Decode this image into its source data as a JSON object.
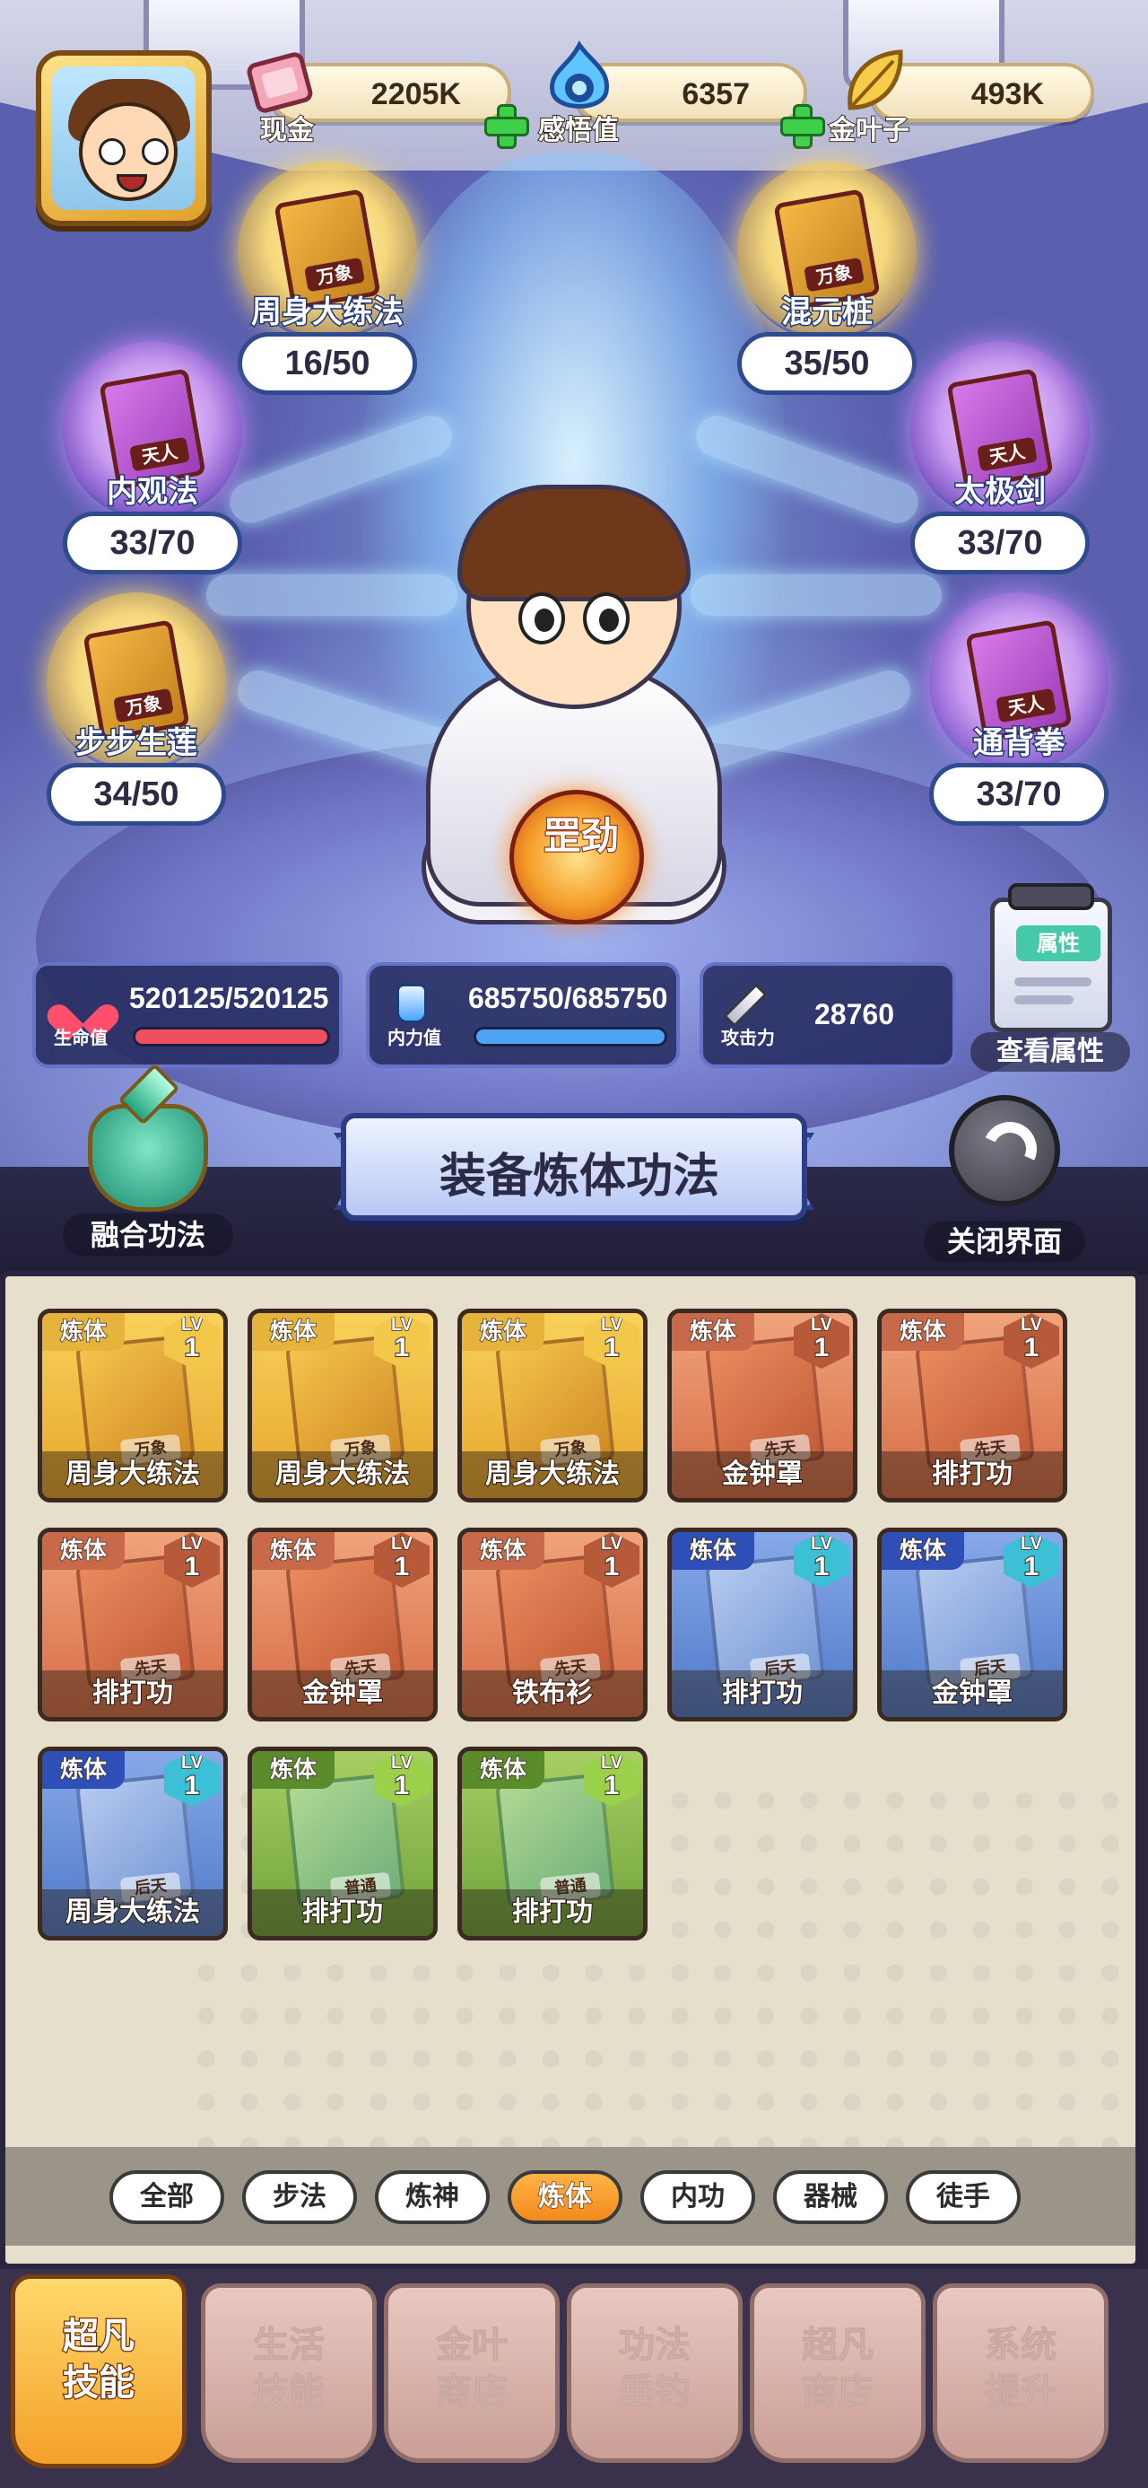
{
  "resources": [
    {
      "label": "现金",
      "value": "2205K",
      "icon": "cash-icon"
    },
    {
      "label": "感悟值",
      "value": "6357",
      "icon": "insight-flame-icon"
    },
    {
      "label": "金叶子",
      "value": "493K",
      "icon": "gold-leaf-icon"
    }
  ],
  "orbs": [
    {
      "name": "周身大练法",
      "count": "16/50",
      "rank": "万象",
      "tier": "gold"
    },
    {
      "name": "混元桩",
      "count": "35/50",
      "rank": "万象",
      "tier": "gold"
    },
    {
      "name": "内观法",
      "count": "33/70",
      "rank": "天人",
      "tier": "purple"
    },
    {
      "name": "太极剑",
      "count": "33/70",
      "rank": "天人",
      "tier": "purple"
    },
    {
      "name": "步步生莲",
      "count": "34/50",
      "rank": "万象",
      "tier": "gold"
    },
    {
      "name": "通背拳",
      "count": "33/70",
      "rank": "天人",
      "tier": "purple"
    }
  ],
  "hero": {
    "emblem": "罡劲"
  },
  "stats": {
    "hp": {
      "label": "生命值",
      "value": "520125/520125",
      "fill": 1.0,
      "color": "#ef4f5f"
    },
    "mp": {
      "label": "内力值",
      "value": "685750/685750",
      "fill": 1.0,
      "color": "#4da3f4"
    },
    "atk": {
      "label": "攻击力",
      "value": "28760"
    }
  },
  "attributes_button": {
    "tag": "属性",
    "label": "查看属性"
  },
  "banner": {
    "title": "装备炼体功法"
  },
  "fuse_button": {
    "label": "融合功法"
  },
  "close_button": {
    "label": "关闭界面"
  },
  "cards": [
    {
      "type": "炼体",
      "lv_label": "LV",
      "level": "1",
      "name": "周身大练法",
      "rank": "万象",
      "color": "gold"
    },
    {
      "type": "炼体",
      "lv_label": "LV",
      "level": "1",
      "name": "周身大练法",
      "rank": "万象",
      "color": "gold"
    },
    {
      "type": "炼体",
      "lv_label": "LV",
      "level": "1",
      "name": "周身大练法",
      "rank": "万象",
      "color": "gold"
    },
    {
      "type": "炼体",
      "lv_label": "LV",
      "level": "1",
      "name": "金钟罩",
      "rank": "先天",
      "color": "orange"
    },
    {
      "type": "炼体",
      "lv_label": "LV",
      "level": "1",
      "name": "排打功",
      "rank": "先天",
      "color": "orange"
    },
    {
      "type": "炼体",
      "lv_label": "LV",
      "level": "1",
      "name": "排打功",
      "rank": "先天",
      "color": "orange"
    },
    {
      "type": "炼体",
      "lv_label": "LV",
      "level": "1",
      "name": "金钟罩",
      "rank": "先天",
      "color": "orange"
    },
    {
      "type": "炼体",
      "lv_label": "LV",
      "level": "1",
      "name": "铁布衫",
      "rank": "先天",
      "color": "orange"
    },
    {
      "type": "炼体",
      "lv_label": "LV",
      "level": "1",
      "name": "排打功",
      "rank": "后天",
      "color": "blue"
    },
    {
      "type": "炼体",
      "lv_label": "LV",
      "level": "1",
      "name": "金钟罩",
      "rank": "后天",
      "color": "blue"
    },
    {
      "type": "炼体",
      "lv_label": "LV",
      "level": "1",
      "name": "周身大练法",
      "rank": "后天",
      "color": "blue"
    },
    {
      "type": "炼体",
      "lv_label": "LV",
      "level": "1",
      "name": "排打功",
      "rank": "普通",
      "color": "green"
    },
    {
      "type": "炼体",
      "lv_label": "LV",
      "level": "1",
      "name": "排打功",
      "rank": "普通",
      "color": "green"
    }
  ],
  "filters": [
    {
      "label": "全部",
      "active": false
    },
    {
      "label": "步法",
      "active": false
    },
    {
      "label": "炼神",
      "active": false
    },
    {
      "label": "炼体",
      "active": true
    },
    {
      "label": "内功",
      "active": false
    },
    {
      "label": "器械",
      "active": false
    },
    {
      "label": "徒手",
      "active": false
    }
  ],
  "nav": [
    {
      "label": "超凡\n技能",
      "active": true
    },
    {
      "label": "生活\n技能",
      "active": false
    },
    {
      "label": "金叶\n商店",
      "active": false
    },
    {
      "label": "功法\n垂钓",
      "active": false
    },
    {
      "label": "超凡\n商店",
      "active": false
    },
    {
      "label": "系统\n提升",
      "active": false
    }
  ]
}
